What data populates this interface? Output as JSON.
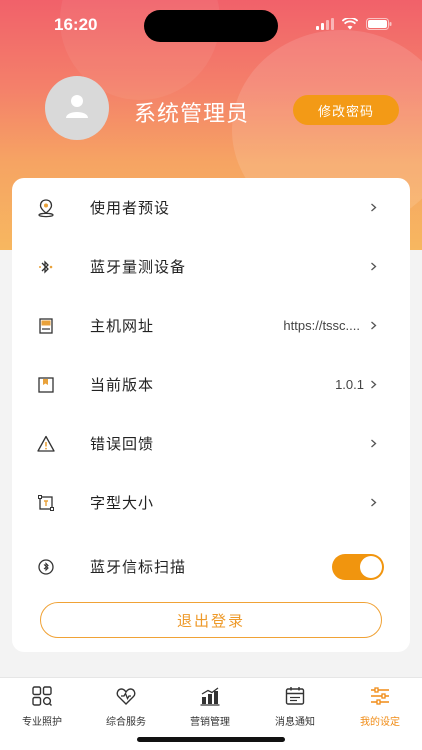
{
  "status_bar": {
    "time": "16:20"
  },
  "profile": {
    "username": "系统管理员",
    "change_password_label": "修改密码"
  },
  "menu": {
    "items": [
      {
        "label": "使用者预设",
        "value": "",
        "icon": "location-pin-icon"
      },
      {
        "label": "蓝牙量测设备",
        "value": "",
        "icon": "bluetooth-icon"
      },
      {
        "label": "主机网址",
        "value": "https://tssc....",
        "icon": "server-icon"
      },
      {
        "label": "当前版本",
        "value": "1.0.1",
        "icon": "version-icon"
      },
      {
        "label": "错误回馈",
        "value": "",
        "icon": "warning-icon"
      },
      {
        "label": "字型大小",
        "value": "",
        "icon": "font-size-icon"
      },
      {
        "label": "蓝牙信标扫描",
        "value": "",
        "icon": "beacon-icon",
        "toggle_on": true
      }
    ],
    "logout_label": "退出登录"
  },
  "tabbar": {
    "tabs": [
      {
        "label": "专业照护",
        "icon": "care-icon"
      },
      {
        "label": "综合服务",
        "icon": "service-icon"
      },
      {
        "label": "营销管理",
        "icon": "marketing-icon"
      },
      {
        "label": "消息通知",
        "icon": "calendar-icon"
      },
      {
        "label": "我的设定",
        "icon": "settings-icon",
        "active": true
      }
    ]
  },
  "colors": {
    "accent": "#f39a16",
    "header_top": "#f1616a",
    "header_bottom": "#f7b760"
  }
}
